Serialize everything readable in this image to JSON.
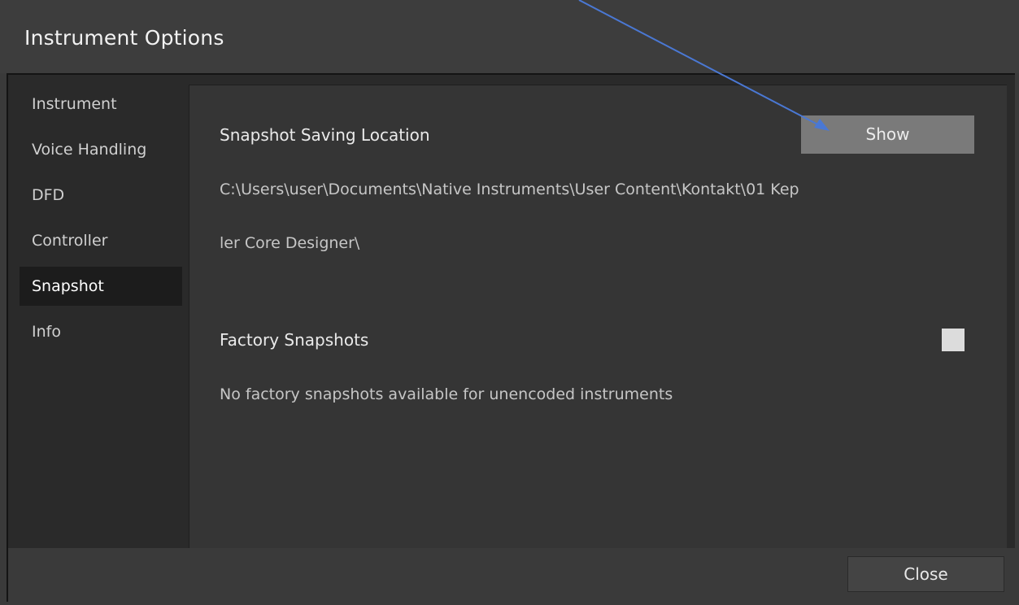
{
  "window": {
    "title": "Instrument Options"
  },
  "sidebar": {
    "items": [
      {
        "label": "Instrument"
      },
      {
        "label": "Voice Handling"
      },
      {
        "label": "DFD"
      },
      {
        "label": "Controller"
      },
      {
        "label": "Snapshot",
        "active": true
      },
      {
        "label": "Info"
      }
    ]
  },
  "snapshot": {
    "saving_location_label": "Snapshot Saving Location",
    "show_button": "Show",
    "path_line1": "C:\\Users\\user\\Documents\\Native Instruments\\User Content\\Kontakt\\01 Kep",
    "path_line2": "ler Core Designer\\",
    "factory_label": "Factory Snapshots",
    "factory_message": "No factory snapshots available for unencoded instruments",
    "factory_checked": false
  },
  "footer": {
    "close_button": "Close"
  },
  "colors": {
    "window_bg": "#3a3a3a",
    "content_bg": "#353535",
    "sidebar_active_bg": "#1c1c1c",
    "show_button_bg": "#7a7a7a",
    "annotation_arrow": "#4a78d4"
  }
}
